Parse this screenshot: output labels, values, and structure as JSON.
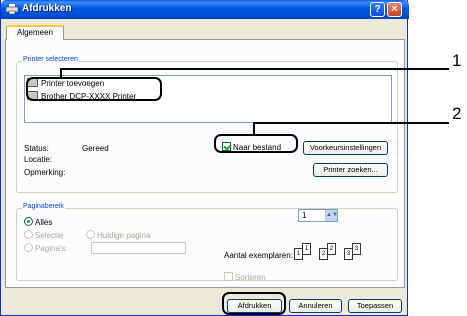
{
  "window": {
    "title": "Afdrukken",
    "help_btn": "?",
    "close_btn": "✕"
  },
  "tabs": [
    {
      "label": "Algemeen"
    }
  ],
  "printer_group": {
    "label": "Printer selecteren",
    "items": [
      {
        "label": "Printer toevoegen",
        "icon": "add-printer-icon"
      },
      {
        "label": "Brother DCP-XXXX   Printer",
        "icon": "printer-icon",
        "selected": true
      }
    ],
    "status_label": "Status:",
    "status_value": "Gereed",
    "location_label": "Locatie:",
    "location_value": "",
    "comment_label": "Opmerking:",
    "comment_value": "",
    "print_to_file_label": "Naar bestand",
    "print_to_file_checked": true,
    "preferences_button": "Voorkeursinstellingen",
    "find_printer_button": "Printer zoeken..."
  },
  "page_range_group": {
    "label": "Paginabereik",
    "all_label": "Alles",
    "selection_label": "Selectie",
    "current_page_label": "Huidige pagina",
    "pages_label": "Pagina's:",
    "pages_value": "",
    "copies_label": "Aantal exemplaren:",
    "copies_value": "1",
    "collate_label": "Sorteren",
    "collate_pages": [
      "1",
      "1",
      "2",
      "2",
      "3",
      "3"
    ]
  },
  "buttons": {
    "print": "Afdrukken",
    "cancel": "Annuleren",
    "apply": "Toepassen"
  },
  "callouts": [
    "1",
    "2"
  ],
  "colors": {
    "titlebar": "#0058e6",
    "dialog_bg": "#ece9d8",
    "group_label": "#0046d5",
    "disabled_text": "#aca899"
  }
}
